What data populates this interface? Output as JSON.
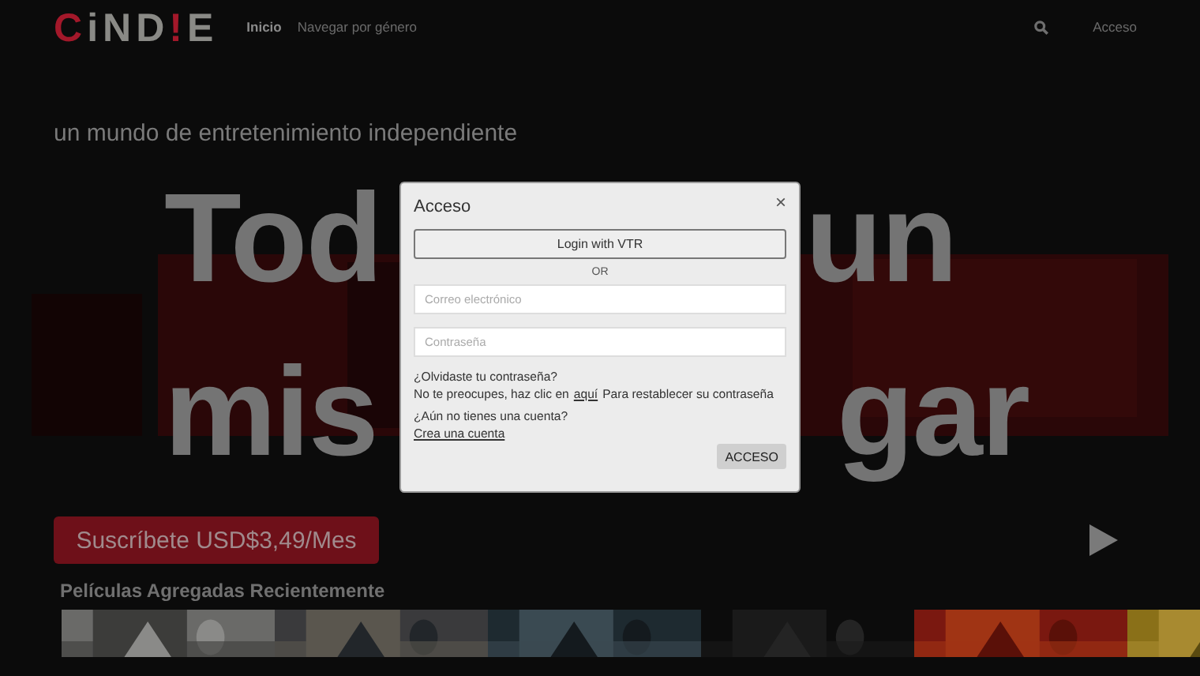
{
  "header": {
    "logo": [
      {
        "char": "C",
        "color": "#a3182a"
      },
      {
        "char": "i",
        "color": "#8a8a86"
      },
      {
        "char": "N",
        "color": "#8a8a86"
      },
      {
        "char": "D",
        "color": "#8a8a86"
      },
      {
        "char": "!",
        "color": "#a3182a"
      },
      {
        "char": "E",
        "color": "#8a8a86"
      }
    ],
    "nav": [
      {
        "label": "Inicio",
        "selected": true
      },
      {
        "label": "Navegar por género",
        "selected": false
      }
    ],
    "login_link": "Acceso"
  },
  "hero": {
    "tagline": "un mundo de entretenimiento independiente",
    "headline_lines": [
      [
        "Tod",
        "un"
      ],
      [
        "mis",
        "gar"
      ]
    ],
    "subscribe_button": "Suscríbete USD$3,49/Mes"
  },
  "section": {
    "title": "Películas Agregadas Recientemente"
  },
  "modal": {
    "title": "Acceso",
    "close": "×",
    "vtr_button": "Login with VTR",
    "separator": "OR",
    "email": {
      "placeholder": "Correo electrónico"
    },
    "password": {
      "placeholder": "Contraseña"
    },
    "forgot_question": "¿Olvidaste tu contraseña?",
    "forgot_before": "No te preocupes, haz clic en",
    "forgot_link": "aquí",
    "forgot_after": "Para restablecer su contraseña",
    "signup_question": "¿Aún no tienes una cuenta?",
    "signup_link": "Crea una cuenta",
    "submit": "ACCESO"
  }
}
